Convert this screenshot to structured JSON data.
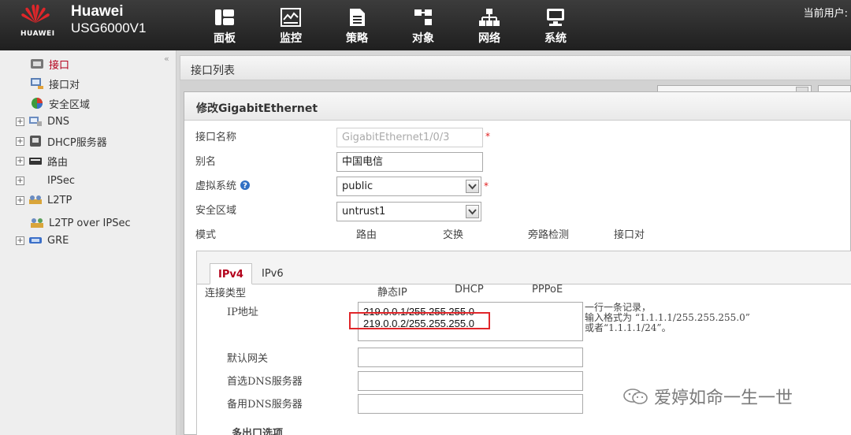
{
  "header": {
    "brand_name": "Huawei",
    "brand_model": "USG6000V1",
    "logo_word": "HUAWEI",
    "current_user_label": "当前用户:",
    "nav": [
      {
        "label": "面板",
        "icon": "dashboard-icon"
      },
      {
        "label": "监控",
        "icon": "monitor-icon"
      },
      {
        "label": "策略",
        "icon": "policy-icon"
      },
      {
        "label": "对象",
        "icon": "object-icon"
      },
      {
        "label": "网络",
        "icon": "network-icon"
      },
      {
        "label": "系统",
        "icon": "system-icon"
      }
    ]
  },
  "sidebar": {
    "collapse_glyph": "«",
    "items": [
      {
        "label": "接口",
        "icon": "interface-icon",
        "expander": "",
        "active": true
      },
      {
        "label": "接口对",
        "icon": "interface-pair-icon",
        "expander": ""
      },
      {
        "label": "安全区域",
        "icon": "security-zone-icon",
        "expander": ""
      },
      {
        "label": "DNS",
        "icon": "dns-icon",
        "expander": "+"
      },
      {
        "label": "DHCP服务器",
        "icon": "dhcp-icon",
        "expander": "+"
      },
      {
        "label": "路由",
        "icon": "route-icon",
        "expander": "+"
      },
      {
        "label": "IPSec",
        "icon": "",
        "expander": "+"
      },
      {
        "label": "L2TP",
        "icon": "l2tp-icon",
        "expander": "+"
      },
      {
        "label": "L2TP over IPSec",
        "icon": "l2tp-ipsec-icon",
        "expander": ""
      },
      {
        "label": "GRE",
        "icon": "gre-icon",
        "expander": "+"
      }
    ]
  },
  "list": {
    "title": "接口列表"
  },
  "modal": {
    "title": "修改GigabitEthernet",
    "fields": {
      "interface_name_label": "接口名称",
      "interface_name_value": "GigabitEthernet1/0/3",
      "alias_label": "别名",
      "alias_value": "中国电信",
      "vsys_label": "虚拟系统",
      "vsys_value": "public",
      "zone_label": "安全区域",
      "zone_value": "untrust1",
      "mode_label": "模式",
      "required_mark": "*"
    },
    "mode_options": [
      "路由",
      "交换",
      "旁路检测",
      "接口对"
    ],
    "tabs": [
      "IPv4",
      "IPv6"
    ],
    "ipv4": {
      "conn_type_label": "连接类型",
      "conn_options": [
        "静态IP",
        "DHCP",
        "PPPoE"
      ],
      "ip_label": "IP地址",
      "ip_lines": [
        "219.0.0.1/255.255.255.0",
        "219.0.0.2/255.255.255.0"
      ],
      "hint_lines": [
        "一行一条记录，",
        "输入格式为 “1.1.1.1/255.255.255.0”",
        "或者“1.1.1.1/24”。"
      ],
      "gateway_label": "默认网关",
      "dns1_label": "首选DNS服务器",
      "dns2_label": "备用DNS服务器",
      "multi_exit_label": "多出口选项"
    }
  },
  "watermark": {
    "text": "爱婷如命一生一世"
  },
  "colors": {
    "accent_red": "#b3001b",
    "highlight_red": "#e0262a",
    "header_dark": "#2a2a2a"
  }
}
